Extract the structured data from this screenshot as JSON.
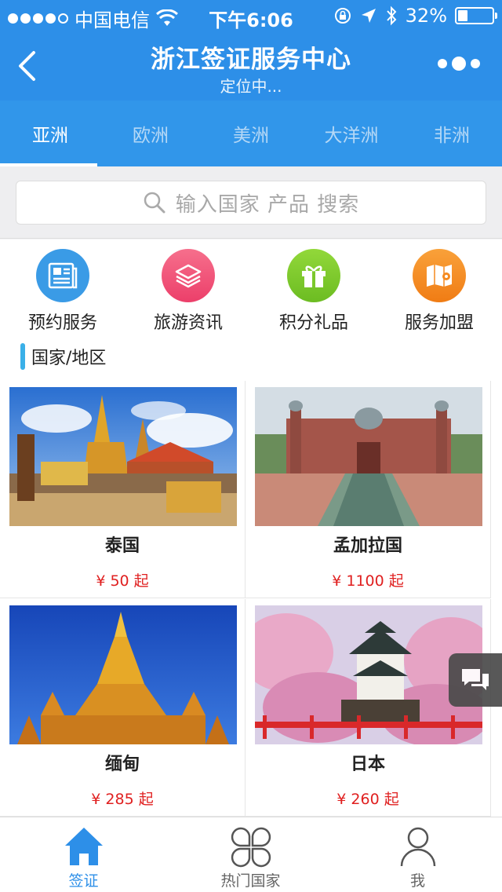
{
  "status_bar": {
    "carrier": "中国电信",
    "time": "下午6:06",
    "battery": "32%",
    "battery_level": 0.32
  },
  "nav": {
    "title": "浙江签证服务中心",
    "subtitle": "定位中..."
  },
  "tabs": [
    {
      "label": "亚洲",
      "active": true
    },
    {
      "label": "欧洲",
      "active": false
    },
    {
      "label": "美洲",
      "active": false
    },
    {
      "label": "大洋洲",
      "active": false
    },
    {
      "label": "非洲",
      "active": false
    }
  ],
  "search": {
    "placeholder": "输入国家 产品 搜索"
  },
  "quick_actions": [
    {
      "label": "预约服务",
      "icon": "document-icon",
      "color": "#3a9be6"
    },
    {
      "label": "旅游资讯",
      "icon": "layers-icon",
      "color": "#f0567a"
    },
    {
      "label": "积分礼品",
      "icon": "gift-icon",
      "color": "#7cc82c"
    },
    {
      "label": "服务加盟",
      "icon": "map-icon",
      "color": "#f58a1f"
    }
  ],
  "section": {
    "title": "国家/地区"
  },
  "countries": [
    {
      "name": "泰国",
      "price": "¥ 50 起"
    },
    {
      "name": "孟加拉国",
      "price": "¥ 1100 起"
    },
    {
      "name": "缅甸",
      "price": "¥ 285 起"
    },
    {
      "name": "日本",
      "price": "¥ 260 起"
    }
  ],
  "tabbar": [
    {
      "label": "签证",
      "icon": "home-icon",
      "active": true
    },
    {
      "label": "热门国家",
      "icon": "clover-icon",
      "active": false
    },
    {
      "label": "我",
      "icon": "user-icon",
      "active": false
    }
  ],
  "colors": {
    "primary": "#2d8fe8",
    "price": "#e02020",
    "accent_bar": "#3ab0e8"
  }
}
